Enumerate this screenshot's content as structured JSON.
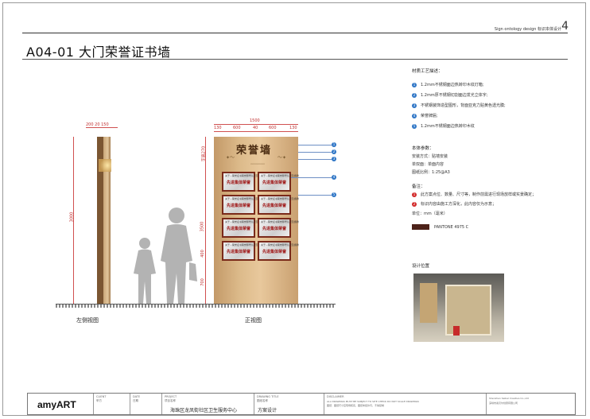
{
  "header": {
    "subtitle": "Sign ontology design 标识本体设计",
    "page_number": "4",
    "title": "A04-01 大门荣誉证书墙"
  },
  "drawing": {
    "side_top_dims": "200 20 150",
    "side_height": "3000",
    "front_width": "1500",
    "front_segments": [
      "130",
      "600",
      "40",
      "600",
      "130"
    ],
    "front_left_dims": [
      "字高270",
      "3500",
      "400",
      "700"
    ],
    "front_title": "荣誉墙",
    "board_header": "关于...荣誉证书荣誉称号认定及授牌",
    "board_text": "先进集体荣誉",
    "callouts": [
      "1",
      "2",
      "3",
      "4",
      "5"
    ],
    "side_caption": "左侧视图",
    "front_caption": "正视图"
  },
  "materials": {
    "heading": "材质工艺描述：",
    "items": [
      {
        "n": "1",
        "text": "1.2mm不锈钢面边热转印木纹灯箱;"
      },
      {
        "n": "2",
        "text": "1.2mm厚不锈钢切割面边发光立体字;"
      },
      {
        "n": "3",
        "text": "不锈钢装饰造型图形，背面亚克力贴黄色透光膜;"
      },
      {
        "n": "4",
        "text": "荣誉牌匾;"
      },
      {
        "n": "5",
        "text": "1.2mm不锈钢面边热转印木纹"
      }
    ]
  },
  "params": {
    "heading": "本体参数：",
    "lines": [
      "安装方式：贴墙安装",
      "单双面：单面内容",
      "图纸比例：1:25@A3"
    ]
  },
  "notes": {
    "heading": "备注：",
    "items": [
      {
        "n": "1",
        "text": "此方案点位、数量、尺寸等，制作前需进行现场放样或实景确定；"
      },
      {
        "n": "2",
        "text": "标识内容由施工方深化，此内容仅为示意；"
      }
    ],
    "unit": "单位：mm（毫米）"
  },
  "pantone": "PANTONE 4975 C",
  "photo_label": "设计位置",
  "footer": {
    "logo": "amyART",
    "client_label": "CLIENT",
    "client_val": "甲方",
    "date_label": "DATE",
    "date_val": "日期",
    "project_label": "PROJECT",
    "project_sub": "项目名称",
    "project_val": "海珠区龙凤街社区卫生服务中心",
    "drawing_label": "DRAWING TITLE",
    "drawing_sub": "图纸名称",
    "drawing_val": "方案设计",
    "disclaimer_label": "DISCLAIMER",
    "disclaimer_1": "ALL DRAWINGS MUST BE SUBJECT TO SITE CHECK DO NOT SCALE DRAWINGS",
    "disclaimer_2": "图纸：图纸尺寸应现场核实，图纸未经许可，不得复制",
    "company_1": "Shenzhen Saibel Creative Co.,Ltd",
    "company_2": "深圳市塞贝尔创意有限公司"
  }
}
